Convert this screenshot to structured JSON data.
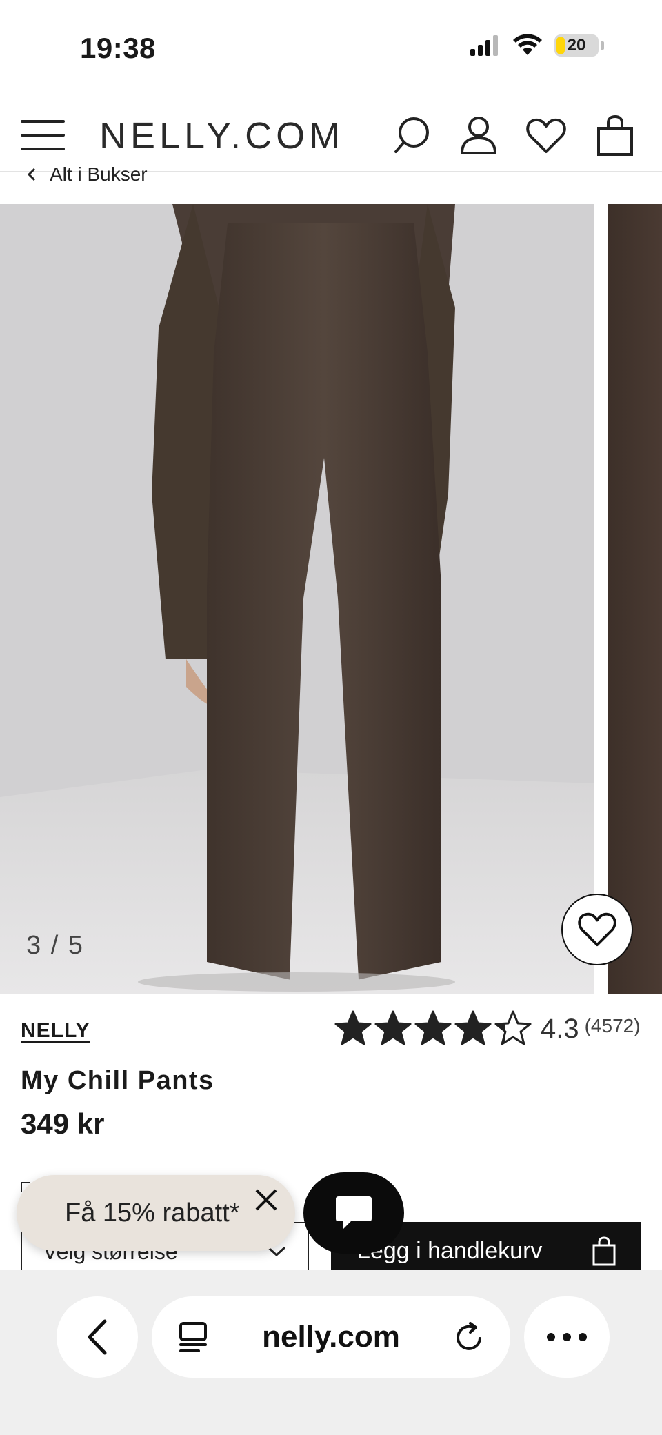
{
  "status_bar": {
    "time": "19:38",
    "battery": "20",
    "battery_level": 0.2,
    "icons": [
      "cellular-signal-icon",
      "wifi-icon",
      "battery-icon"
    ]
  },
  "header": {
    "logo": "NELLY.COM",
    "icons": [
      "menu-icon",
      "search-icon",
      "account-icon",
      "wishlist-icon",
      "bag-icon"
    ]
  },
  "breadcrumb": {
    "back_label": "Alt i Bukser"
  },
  "gallery": {
    "counter": "3 / 5",
    "current": 3,
    "total": 5
  },
  "product": {
    "brand": "NELLY",
    "rating": "4.3",
    "rating_stars": 4.3,
    "review_count": "(4572)",
    "title": "My Chill Pants",
    "price": "349 kr"
  },
  "purchase": {
    "size_label": "Velg størrelse",
    "add_to_cart_label": "Legg i handlekurv"
  },
  "promo": {
    "label": "Få 15% rabatt*"
  },
  "browser": {
    "url": "nelly.com"
  },
  "colors": {
    "brand_dark": "#111111",
    "promo_bg": "#e9e3dc",
    "battery": "#ffd60a",
    "pants": "#4a3d35"
  }
}
